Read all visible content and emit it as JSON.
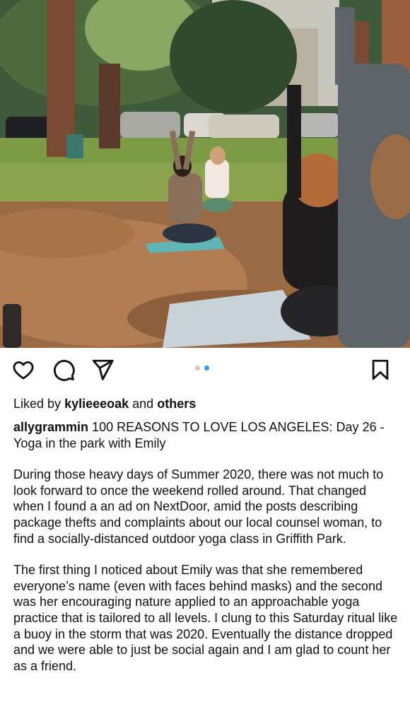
{
  "post": {
    "image_description_icon": "photo",
    "carousel": {
      "count": 2,
      "active_index": 1
    },
    "likes": {
      "prefix": "Liked by",
      "user": "kylieeeoak",
      "joiner": "and",
      "others": "others"
    },
    "caption": {
      "username": "allygrammin",
      "headline": "100 REASONS TO LOVE LOS ANGELES: Day 26 - Yoga in the park with Emily",
      "paragraph1": "During those heavy days of Summer 2020, there was not much to look forward to once the weekend rolled around. That changed when I found a an ad on NextDoor, amid the posts describing package thefts and complaints about our local counsel woman, to find a socially-distanced outdoor yoga class in Griffith Park.",
      "paragraph2": "The first thing I noticed about Emily was that she remembered everyone’s name (even with faces behind masks) and the second was her encouraging nature applied to an approachable yoga practice that is tailored to all levels.  I clung to this Saturday ritual like a buoy in the storm that was 2020. Eventually the distance dropped and we were able to just be social again and I am glad to count her as a friend."
    },
    "icons": {
      "like": "heart-icon",
      "comment": "comment-icon",
      "share": "send-icon",
      "save": "bookmark-icon"
    }
  }
}
